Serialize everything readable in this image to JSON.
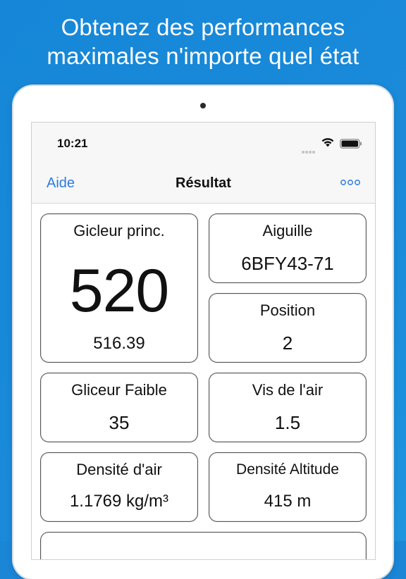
{
  "headline": {
    "line1": "Obtenez des performances",
    "line2": "maximales n'importe quel état"
  },
  "status": {
    "time": "10:21"
  },
  "nav": {
    "left": "Aide",
    "title": "Résultat"
  },
  "cards": {
    "main_jet": {
      "label": "Gicleur princ.",
      "value": "520",
      "exact": "516.39"
    },
    "needle": {
      "label": "Aiguille",
      "value": "6BFY43-71"
    },
    "position": {
      "label": "Position",
      "value": "2"
    },
    "pilot_jet": {
      "label": "Gliceur Faible",
      "value": "35"
    },
    "air_screw": {
      "label": "Vis de l'air",
      "value": "1.5"
    },
    "air_density": {
      "label": "Densité d'air",
      "value": "1.1769 kg/m³"
    },
    "density_altitude": {
      "label": "Densité Altitude",
      "value": "415 m"
    }
  },
  "colors": {
    "background": "#1b86d6",
    "accent": "#2d7be0"
  }
}
